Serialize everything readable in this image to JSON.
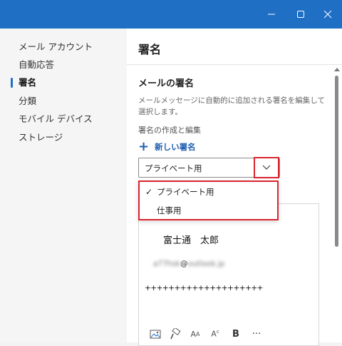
{
  "sidebar": {
    "items": [
      {
        "label": "メール アカウント"
      },
      {
        "label": "自動応答"
      },
      {
        "label": "署名",
        "active": true
      },
      {
        "label": "分類"
      },
      {
        "label": "モバイル デバイス"
      },
      {
        "label": "ストレージ"
      }
    ]
  },
  "main": {
    "title": "署名",
    "section_title": "メールの署名",
    "section_desc": "メールメッセージに自動的に追加される署名を編集して選択します。",
    "sub_label": "署名の作成と編集",
    "new_signature": "新しい署名",
    "select_value": "プライベート用",
    "dropdown_options": [
      {
        "label": "プライベート用",
        "selected": true
      },
      {
        "label": "仕事用",
        "selected": false
      }
    ],
    "signature": {
      "name": "富士通　太郎",
      "email_local": "a77hsk",
      "email_at": "@",
      "email_domain": "outlook.jp",
      "plus_line": "++++++++++++++++++++"
    }
  },
  "colors": {
    "accent": "#1f6fc5",
    "highlight": "#d9252f"
  },
  "icons": {
    "window_controls": [
      "minimize-icon",
      "maximize-icon",
      "close-icon"
    ],
    "new_signature": "plus-icon",
    "dropdown": "chevron-down-icon",
    "selected": "checkmark-icon",
    "toolbar": [
      "image-icon",
      "format-painter-icon",
      "font-size-icon",
      "superscript-icon",
      "bold-icon",
      "more-icon"
    ]
  }
}
